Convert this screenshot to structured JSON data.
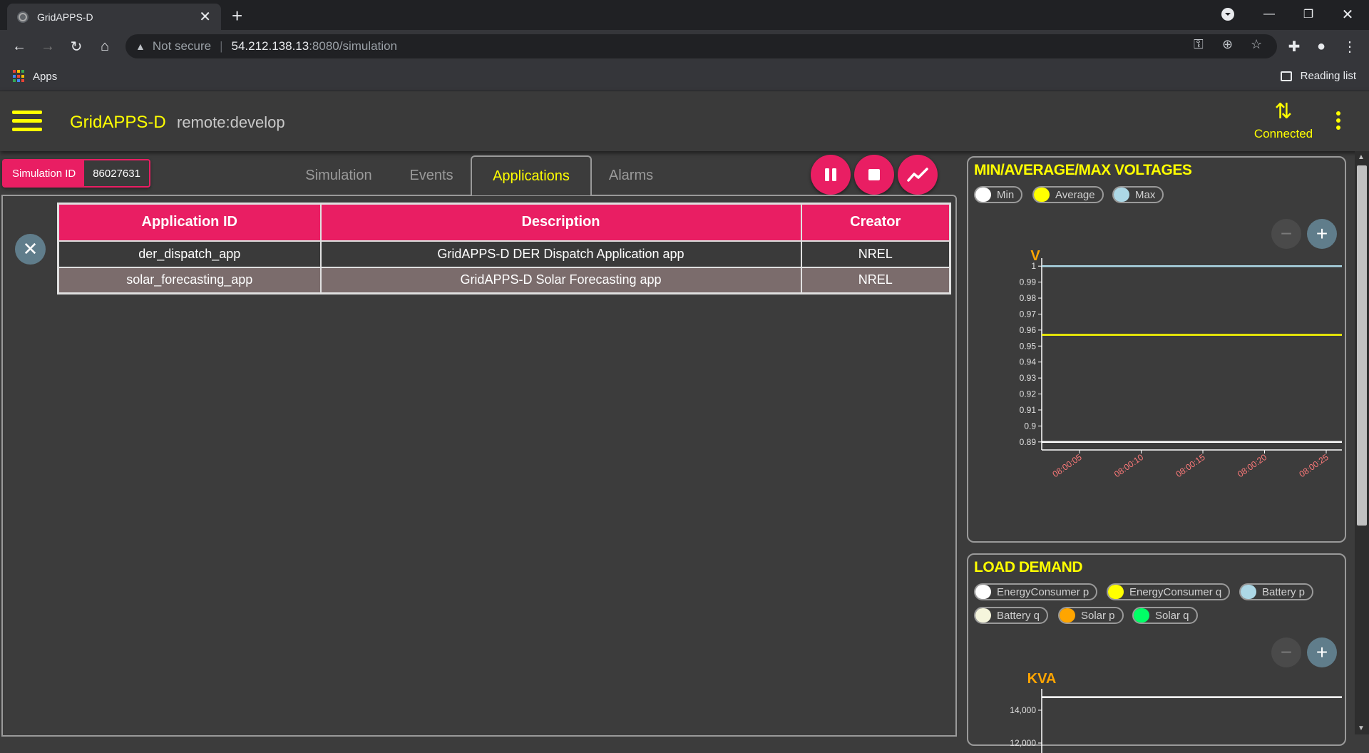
{
  "browser": {
    "tab_title": "GridAPPS-D",
    "url_warning": "Not secure",
    "url_host": "54.212.138.13",
    "url_path": ":8080/simulation",
    "bookmarks_apps": "Apps",
    "reading_list": "Reading list"
  },
  "header": {
    "title": "GridAPPS-D",
    "subtitle": "remote:develop",
    "status": "Connected"
  },
  "simulation": {
    "id_label": "Simulation ID",
    "id_value": "86027631"
  },
  "tabs": [
    {
      "label": "Simulation",
      "active": false
    },
    {
      "label": "Events",
      "active": false
    },
    {
      "label": "Applications",
      "active": true
    },
    {
      "label": "Alarms",
      "active": false
    }
  ],
  "controls": {
    "pause": "pause-icon",
    "stop": "stop-icon",
    "chart": "trending-icon"
  },
  "apps_table": {
    "headers": [
      "Application ID",
      "Description",
      "Creator"
    ],
    "rows": [
      [
        "der_dispatch_app",
        "GridAPPS-D DER Dispatch Application app",
        "NREL"
      ],
      [
        "solar_forecasting_app",
        "GridAPPS-D Solar Forecasting app",
        "NREL"
      ]
    ]
  },
  "voltage_card": {
    "title": "MIN/AVERAGE/MAX VOLTAGES",
    "legend": [
      {
        "label": "Min",
        "color": "#ffffff"
      },
      {
        "label": "Average",
        "color": "#ffff00"
      },
      {
        "label": "Max",
        "color": "#add8e6"
      }
    ]
  },
  "load_card": {
    "title": "LOAD DEMAND",
    "legend": [
      {
        "label": "EnergyConsumer p",
        "color": "#ffffff"
      },
      {
        "label": "EnergyConsumer q",
        "color": "#ffff00"
      },
      {
        "label": "Battery p",
        "color": "#add8e6"
      },
      {
        "label": "Battery q",
        "color": "#f5f5dc"
      },
      {
        "label": "Solar p",
        "color": "#ffa500"
      },
      {
        "label": "Solar q",
        "color": "#00ff66"
      }
    ]
  },
  "chart_data": [
    {
      "type": "line",
      "ylabel": "V",
      "ylim": [
        0.885,
        1.005
      ],
      "yticks": [
        "1",
        "0.99",
        "0.98",
        "0.97",
        "0.96",
        "0.95",
        "0.94",
        "0.93",
        "0.92",
        "0.91",
        "0.9",
        "0.89"
      ],
      "x": [
        "08:00:05",
        "08:00:10",
        "08:00:15",
        "08:00:20",
        "08:00:25"
      ],
      "series": [
        {
          "name": "Min",
          "color": "#ffffff",
          "values": [
            0.89,
            0.89,
            0.89,
            0.89,
            0.89
          ]
        },
        {
          "name": "Average",
          "color": "#ffff00",
          "values": [
            0.957,
            0.957,
            0.957,
            0.957,
            0.957
          ]
        },
        {
          "name": "Max",
          "color": "#add8e6",
          "values": [
            1.0,
            1.0,
            1.0,
            1.0,
            1.0
          ]
        }
      ]
    },
    {
      "type": "line",
      "ylabel": "KVA",
      "yticks": [
        "14,000",
        "12,000"
      ],
      "series": [
        {
          "name": "EnergyConsumer p",
          "color": "#ffffff",
          "values": [
            14800,
            14800,
            14800,
            14800,
            14800
          ]
        }
      ]
    }
  ]
}
